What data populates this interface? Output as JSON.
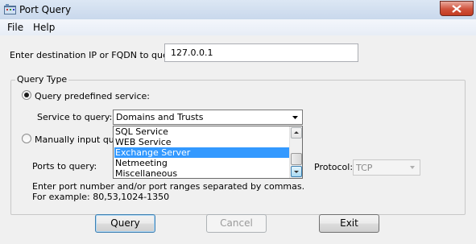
{
  "window": {
    "title": "Port Query"
  },
  "menu": {
    "file": "File",
    "help": "Help"
  },
  "destination": {
    "label": "Enter destination IP or FQDN to query:",
    "value": "127.0.0.1"
  },
  "query_type": {
    "legend": "Query Type",
    "predefined_label": "Query predefined service:",
    "manual_label": "Manually input query",
    "selected": "predefined"
  },
  "service": {
    "label": "Service to query:",
    "selected": "Domains and Trusts",
    "list": [
      "SQL Service",
      "WEB Service",
      "Exchange Server",
      "Netmeeting",
      "Miscellaneous"
    ],
    "highlighted_index": 2
  },
  "ports": {
    "label": "Ports to query:",
    "hint_line1": "Enter port number and/or port ranges separated by commas.",
    "hint_line2": "For example: 80,53,1024-1350"
  },
  "protocol": {
    "label": "Protocol:",
    "value": "TCP"
  },
  "buttons": {
    "query": "Query",
    "cancel": "Cancel",
    "exit": "Exit"
  },
  "colors": {
    "selection": "#3399ff",
    "close_button": "#c33b21"
  }
}
